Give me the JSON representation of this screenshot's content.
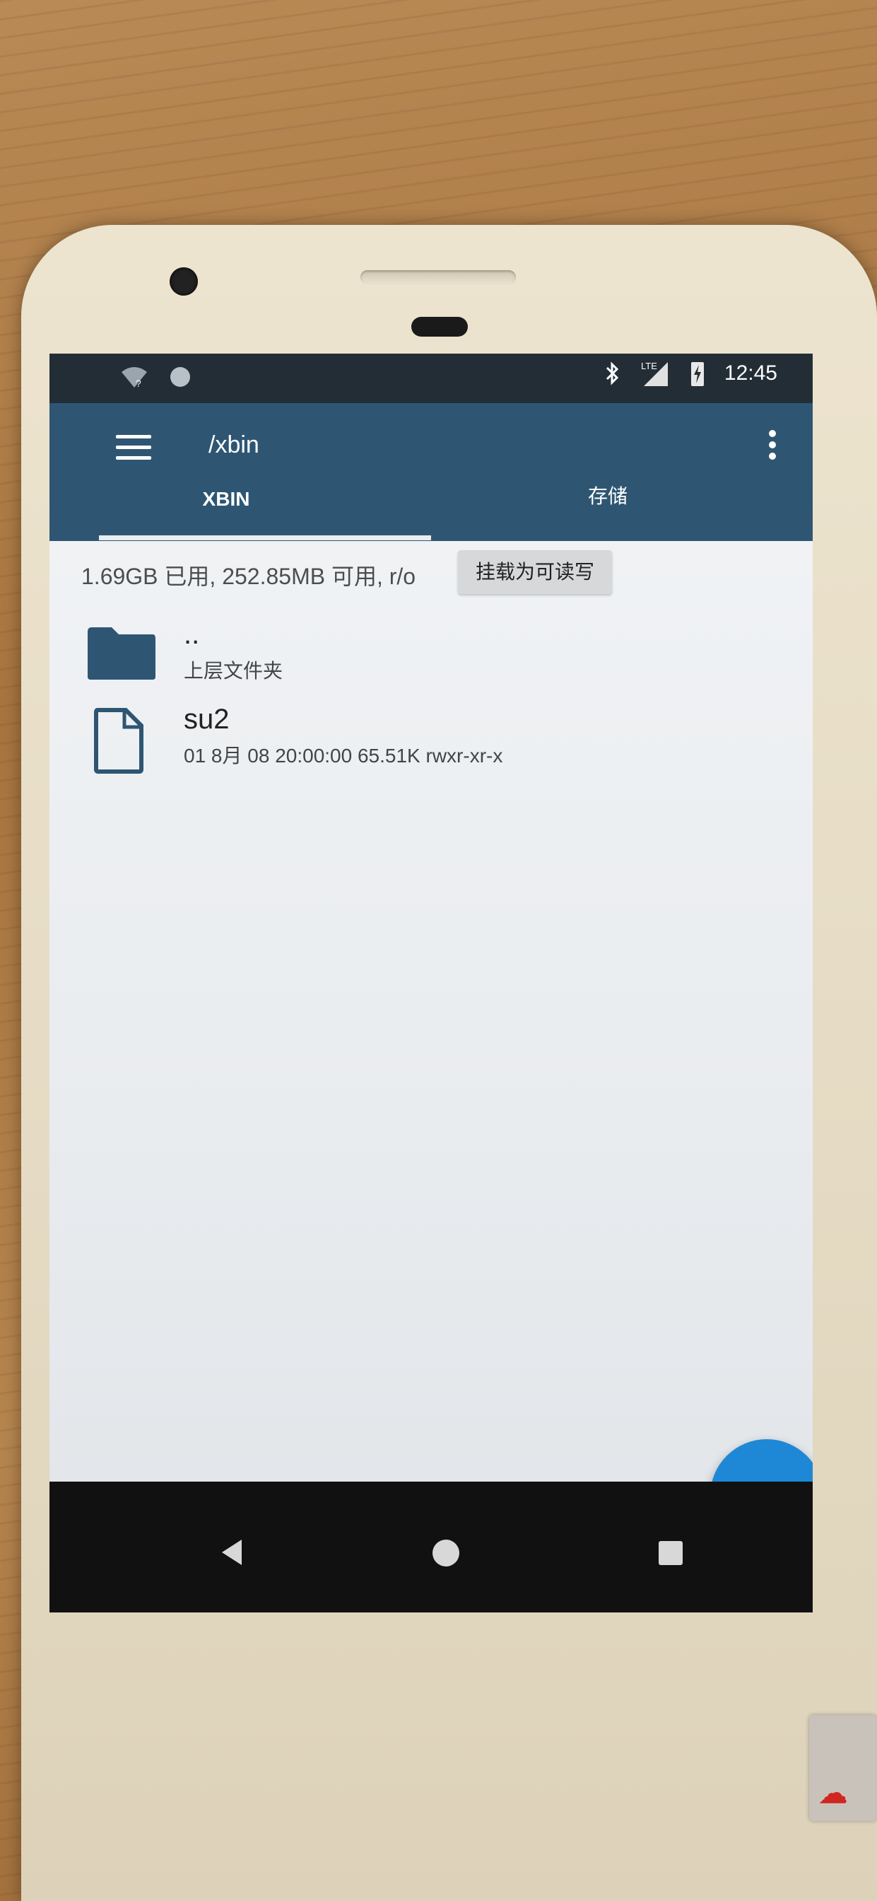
{
  "status_bar": {
    "time": "12:45",
    "network": "LTE",
    "icons": [
      "wifi-unknown-icon",
      "notification-circle-icon",
      "bluetooth-icon",
      "lte-signal-icon",
      "battery-charging-icon"
    ]
  },
  "app_bar": {
    "menu_icon": "hamburger-menu-icon",
    "path": "/xbin",
    "more_icon": "more-vertical-icon"
  },
  "tabs": [
    {
      "label": "XBIN",
      "active": true
    },
    {
      "label": "存储",
      "active": false
    }
  ],
  "storage": {
    "info": "1.69GB 已用, 252.85MB 可用, r/o",
    "mount_button": "挂载为可读写"
  },
  "files": [
    {
      "name": "..",
      "subtitle": "上层文件夹",
      "icon": "folder-icon"
    },
    {
      "name": "su2",
      "subtitle": "01 8月 08 20:00:00  65.51K  rwxr-xr-x",
      "icon": "file-icon"
    }
  ],
  "fab": {
    "label": "+",
    "icon": "add-icon"
  },
  "nav_bar": {
    "icons": [
      "back-icon",
      "home-icon",
      "recents-icon"
    ]
  },
  "colors": {
    "app_bar": "#2e5673",
    "status_bar": "#232d35",
    "fab": "#1e88d6",
    "icon": "#2e5673"
  }
}
